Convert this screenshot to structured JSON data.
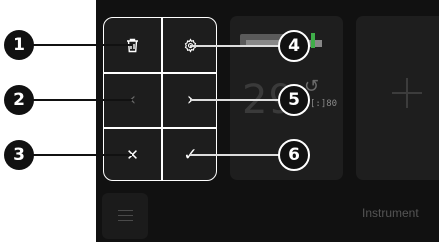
{
  "background_panel": {
    "reading": "29",
    "small_readout": "[:]80",
    "instruments_label": "Instrument"
  },
  "actions": [
    {
      "name": "delete",
      "icon": "trash-icon",
      "enabled": true
    },
    {
      "name": "settings",
      "icon": "gear-icon",
      "enabled": true
    },
    {
      "name": "previous",
      "icon": "chevron-left-icon",
      "label": "‹",
      "enabled": false
    },
    {
      "name": "next",
      "icon": "chevron-right-icon",
      "label": "›",
      "enabled": true
    },
    {
      "name": "cancel",
      "icon": "close-icon",
      "label": "✕",
      "enabled": true
    },
    {
      "name": "confirm",
      "icon": "check-icon",
      "label": "✓",
      "enabled": true
    }
  ],
  "callouts": [
    "1",
    "2",
    "3",
    "4",
    "5",
    "6"
  ],
  "colors": {
    "screen_bg": "#111111",
    "tile_bg": "#1e1e1e",
    "accent_green": "#3fae49",
    "outline": "#ffffff"
  }
}
